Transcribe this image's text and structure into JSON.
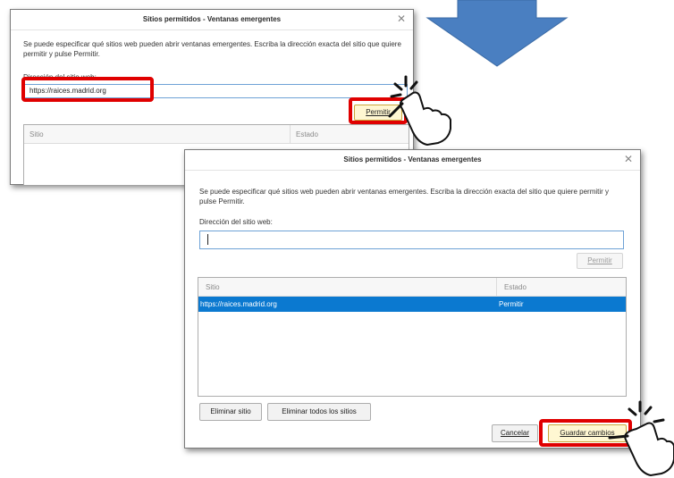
{
  "colors": {
    "highlight": "#e00000",
    "arrow": "#4a7fc1",
    "selection": "#0b79d0"
  },
  "back_dialog": {
    "title": "Sitios permitidos - Ventanas emergentes",
    "description": "Se puede especificar qué sitios web pueden abrir ventanas emergentes. Escriba la dirección exacta del sitio que quiere permitir y pulse Permitir.",
    "address_label": "Dirección del sitio web:",
    "address_value": "https://raices.madrid.org",
    "allow_button": "Permitir",
    "col_site": "Sitio",
    "col_status": "Estado"
  },
  "front_dialog": {
    "title": "Sitios permitidos - Ventanas emergentes",
    "description": "Se puede especificar qué sitios web pueden abrir ventanas emergentes. Escriba la dirección exacta del sitio que quiere permitir y pulse Permitir.",
    "address_label": "Dirección del sitio web:",
    "address_value": "",
    "allow_button": "Permitir",
    "col_site": "Sitio",
    "col_status": "Estado",
    "rows": [
      {
        "site": "https://raices.madrid.org",
        "status": "Permitir"
      }
    ],
    "remove_site_button": "Eliminar sitio",
    "remove_all_button": "Eliminar todos los sitios",
    "cancel_button": "Cancelar",
    "save_button": "Guardar cambios"
  },
  "icons": {
    "arrow": "down-arrow-icon",
    "pointer": "hand-pointer-icon"
  }
}
